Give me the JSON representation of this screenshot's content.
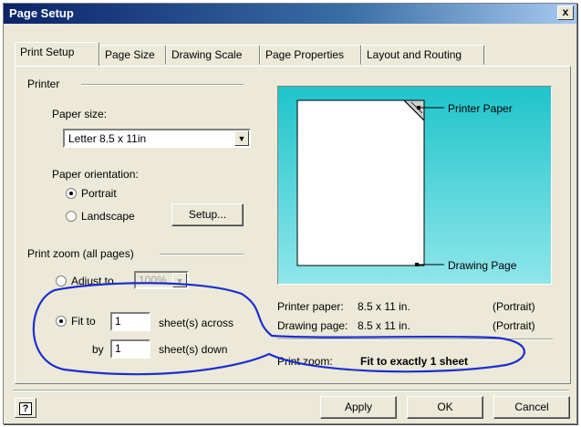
{
  "window": {
    "title": "Page Setup",
    "close_label": "x"
  },
  "tabs": [
    {
      "label": "Print Setup",
      "active": true
    },
    {
      "label": "Page Size"
    },
    {
      "label": "Drawing Scale"
    },
    {
      "label": "Page Properties"
    },
    {
      "label": "Layout and Routing"
    }
  ],
  "printer": {
    "group_label": "Printer",
    "paper_size_label": "Paper size:",
    "paper_size_value": "Letter 8.5 x 11in",
    "orientation_label": "Paper orientation:",
    "portrait_label": "Portrait",
    "landscape_label": "Landscape",
    "selected_orientation": "Portrait",
    "setup_button": "Setup..."
  },
  "zoom": {
    "group_label": "Print zoom (all pages)",
    "adjust_label": "Adjust to",
    "adjust_value": "100%",
    "fit_label": "Fit to",
    "across_value": "1",
    "across_label": "sheet(s) across",
    "by_label": "by",
    "down_value": "1",
    "down_label": "sheet(s) down",
    "selected": "Fit to"
  },
  "preview": {
    "printer_paper_label": "Printer Paper",
    "drawing_page_label": "Drawing Page"
  },
  "info": {
    "printer_paper_label": "Printer paper:",
    "printer_paper_value": "8.5 x 11 in.",
    "printer_paper_orientation": "(Portrait)",
    "drawing_page_label": "Drawing page:",
    "drawing_page_value": "8.5 x 11 in.",
    "drawing_page_orientation": "(Portrait)",
    "print_zoom_label": "Print zoom:",
    "print_zoom_value": "Fit to exactly 1 sheet"
  },
  "buttons": {
    "help": "?",
    "apply": "Apply",
    "ok": "OK",
    "cancel": "Cancel"
  },
  "colors": {
    "annotation": "#1a2fd0",
    "preview_bg": "#1fc4cb",
    "title_bar": "#0a246a"
  }
}
